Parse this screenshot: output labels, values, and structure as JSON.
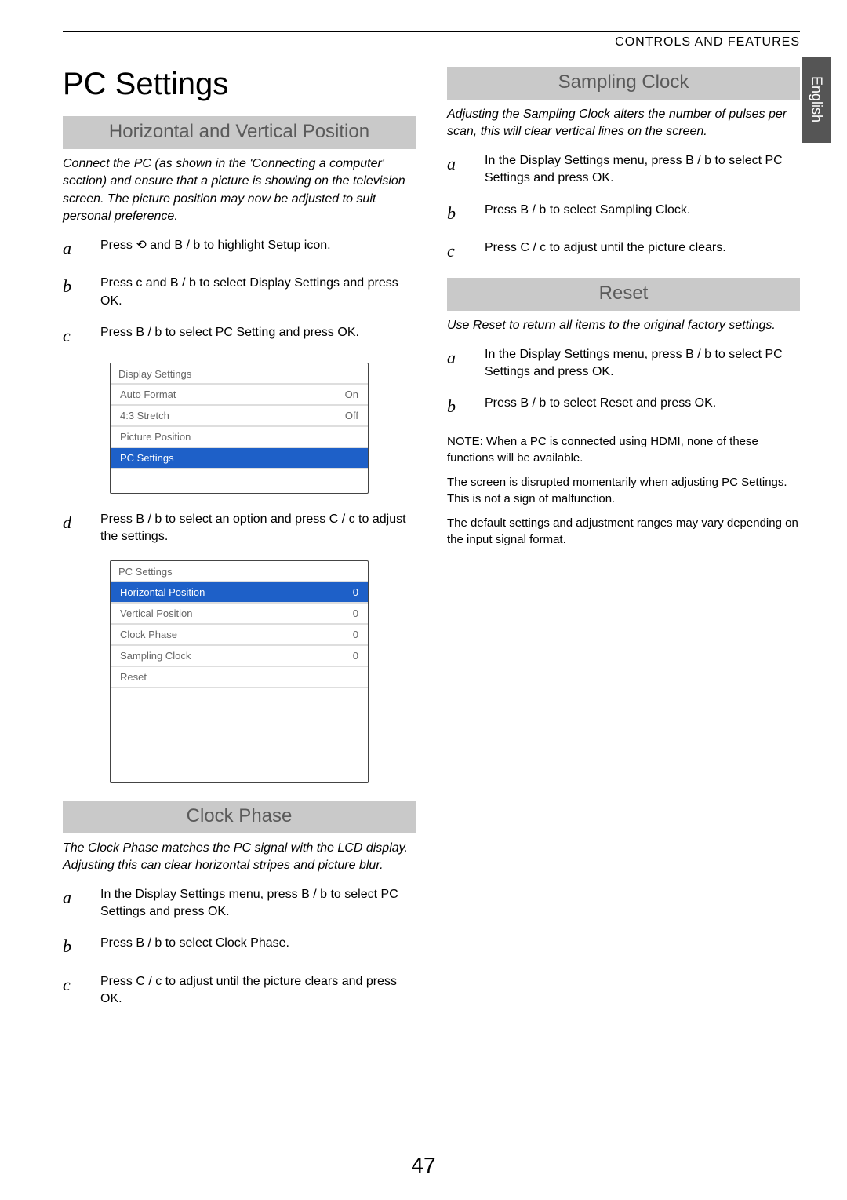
{
  "header": {
    "right": "CONTROLS AND FEATURES"
  },
  "lang": "English",
  "page_number": "47",
  "left": {
    "title": "PC Settings",
    "hv": {
      "bar": "Horizontal and Vertical Position",
      "intro": "Connect the PC (as shown in the 'Connecting a computer' section) and ensure that a picture is showing on the television screen. The picture position may now be adjusted to suit personal preference.",
      "steps": {
        "a": "Press ⟲ and B / b to highlight Setup icon.",
        "b": "Press c and B / b to select Display Settings and press OK.",
        "c": "Press B / b to select PC Setting and press OK.",
        "d": "Press B / b to select an option and press C / c to adjust the settings."
      },
      "menu1": {
        "title": "Display Settings",
        "rows": [
          {
            "label": "Auto Format",
            "value": "On"
          },
          {
            "label": "4:3 Stretch",
            "value": "Off"
          },
          {
            "label": "Picture Position",
            "value": ""
          },
          {
            "label": "PC Settings",
            "value": "",
            "selected": true
          }
        ]
      },
      "menu2": {
        "title": "PC Settings",
        "rows": [
          {
            "label": "Horizontal Position",
            "value": "0"
          },
          {
            "label": "Vertical Position",
            "value": "0"
          },
          {
            "label": "Clock Phase",
            "value": "0"
          },
          {
            "label": "Sampling Clock",
            "value": "0"
          },
          {
            "label": "Reset",
            "value": ""
          }
        ]
      }
    },
    "clock_phase": {
      "bar": "Clock Phase",
      "intro": "The Clock Phase matches the PC signal with the LCD display. Adjusting this can clear horizontal stripes and picture blur.",
      "steps": {
        "a": "In the Display Settings menu, press B / b to select PC Settings and press OK.",
        "b": "Press B / b to select Clock Phase.",
        "c": "Press C / c to adjust until the picture clears and press OK."
      }
    }
  },
  "right": {
    "sampling": {
      "bar": "Sampling Clock",
      "intro": "Adjusting the Sampling Clock alters the number of pulses per scan, this will clear vertical lines on the screen.",
      "steps": {
        "a": "In the Display Settings menu, press B / b to select PC Settings and press OK.",
        "b": "Press B / b to select Sampling Clock.",
        "c": "Press C / c to adjust until the picture clears."
      }
    },
    "reset": {
      "bar": "Reset",
      "intro": "Use Reset to return all items to the original factory settings.",
      "steps": {
        "a": "In the Display Settings menu, press B / b to select PC Settings and press OK.",
        "b": "Press B / b to select Reset and press OK."
      }
    },
    "notes": {
      "n1": "NOTE: When a PC is connected using HDMI, none of these functions will be available.",
      "n2": "The screen is disrupted momentarily when adjusting PC Settings. This is not a sign of malfunction.",
      "n3": "The default settings and adjustment ranges may vary depending on the input signal format."
    }
  }
}
